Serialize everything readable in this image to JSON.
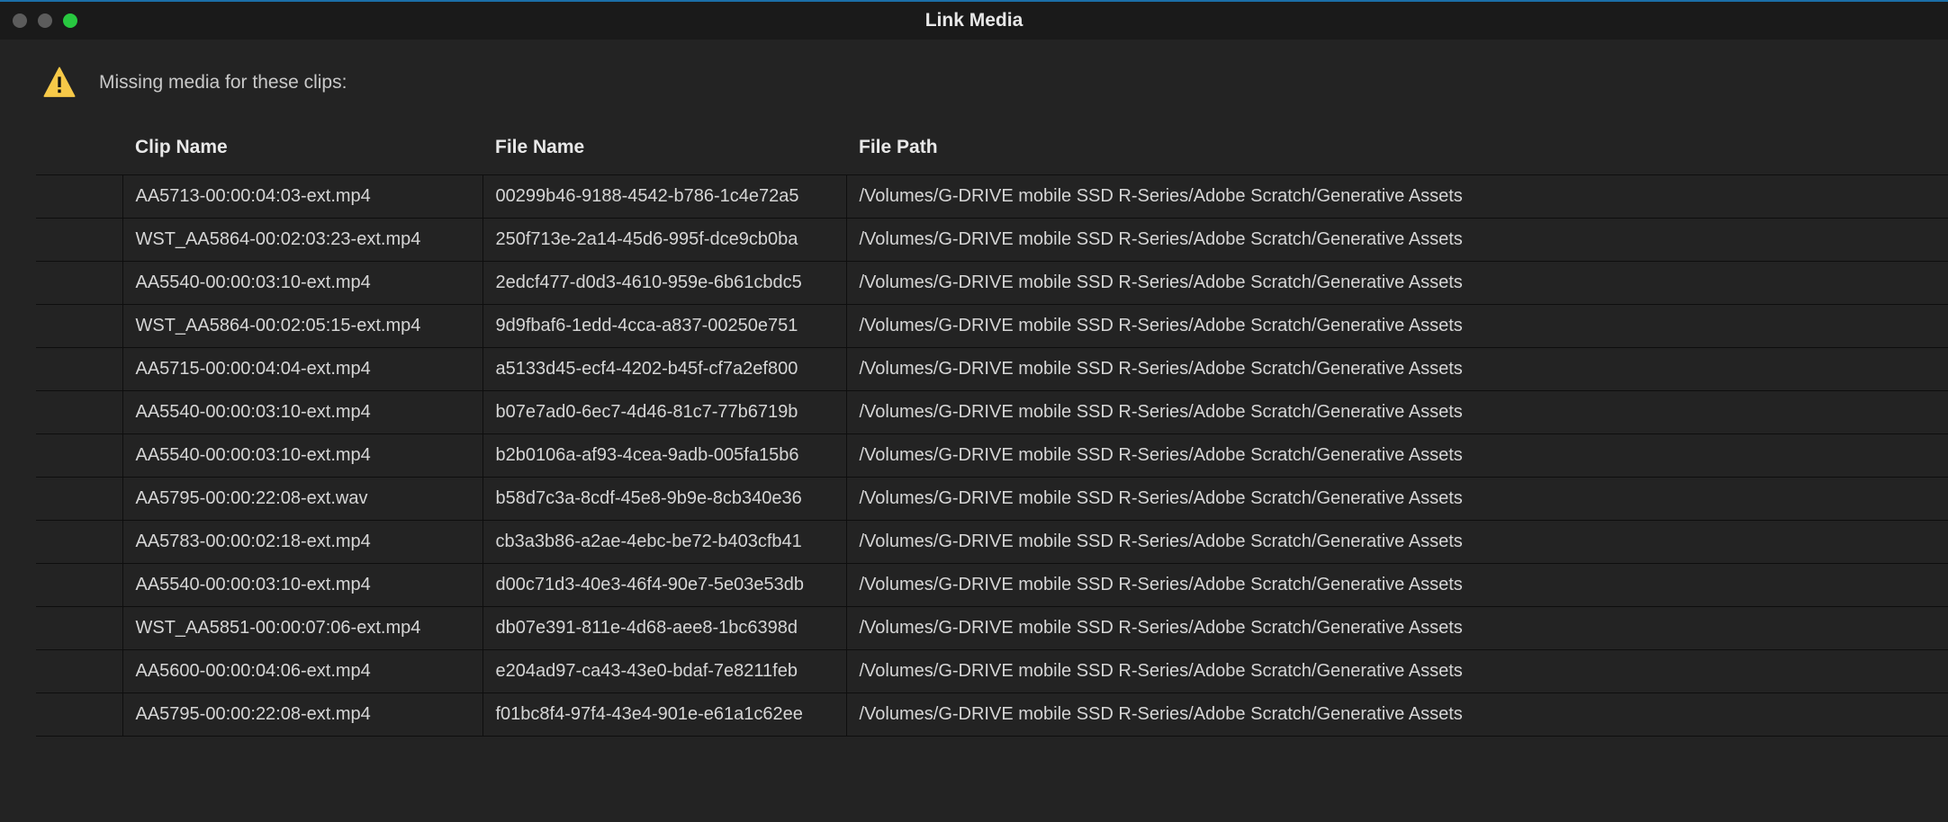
{
  "window": {
    "title": "Link Media"
  },
  "message": "Missing media for these clips:",
  "columns": {
    "clip": "Clip Name",
    "file": "File Name",
    "path": "File Path"
  },
  "rows": [
    {
      "clip": "AA5713-00:00:04:03-ext.mp4",
      "file": "00299b46-9188-4542-b786-1c4e72a5",
      "path": "/Volumes/G-DRIVE mobile SSD R-Series/Adobe Scratch/Generative Assets"
    },
    {
      "clip": "WST_AA5864-00:02:03:23-ext.mp4",
      "file": "250f713e-2a14-45d6-995f-dce9cb0ba",
      "path": "/Volumes/G-DRIVE mobile SSD R-Series/Adobe Scratch/Generative Assets"
    },
    {
      "clip": "AA5540-00:00:03:10-ext.mp4",
      "file": "2edcf477-d0d3-4610-959e-6b61cbdc5",
      "path": "/Volumes/G-DRIVE mobile SSD R-Series/Adobe Scratch/Generative Assets"
    },
    {
      "clip": "WST_AA5864-00:02:05:15-ext.mp4",
      "file": "9d9fbaf6-1edd-4cca-a837-00250e751",
      "path": "/Volumes/G-DRIVE mobile SSD R-Series/Adobe Scratch/Generative Assets"
    },
    {
      "clip": "AA5715-00:00:04:04-ext.mp4",
      "file": "a5133d45-ecf4-4202-b45f-cf7a2ef800",
      "path": "/Volumes/G-DRIVE mobile SSD R-Series/Adobe Scratch/Generative Assets"
    },
    {
      "clip": "AA5540-00:00:03:10-ext.mp4",
      "file": "b07e7ad0-6ec7-4d46-81c7-77b6719b",
      "path": "/Volumes/G-DRIVE mobile SSD R-Series/Adobe Scratch/Generative Assets"
    },
    {
      "clip": "AA5540-00:00:03:10-ext.mp4",
      "file": "b2b0106a-af93-4cea-9adb-005fa15b6",
      "path": "/Volumes/G-DRIVE mobile SSD R-Series/Adobe Scratch/Generative Assets"
    },
    {
      "clip": "AA5795-00:00:22:08-ext.wav",
      "file": "b58d7c3a-8cdf-45e8-9b9e-8cb340e36",
      "path": "/Volumes/G-DRIVE mobile SSD R-Series/Adobe Scratch/Generative Assets"
    },
    {
      "clip": "AA5783-00:00:02:18-ext.mp4",
      "file": "cb3a3b86-a2ae-4ebc-be72-b403cfb41",
      "path": "/Volumes/G-DRIVE mobile SSD R-Series/Adobe Scratch/Generative Assets"
    },
    {
      "clip": "AA5540-00:00:03:10-ext.mp4",
      "file": "d00c71d3-40e3-46f4-90e7-5e03e53db",
      "path": "/Volumes/G-DRIVE mobile SSD R-Series/Adobe Scratch/Generative Assets"
    },
    {
      "clip": "WST_AA5851-00:00:07:06-ext.mp4",
      "file": "db07e391-811e-4d68-aee8-1bc6398d",
      "path": "/Volumes/G-DRIVE mobile SSD R-Series/Adobe Scratch/Generative Assets"
    },
    {
      "clip": "AA5600-00:00:04:06-ext.mp4",
      "file": "e204ad97-ca43-43e0-bdaf-7e8211feb",
      "path": "/Volumes/G-DRIVE mobile SSD R-Series/Adobe Scratch/Generative Assets"
    },
    {
      "clip": "AA5795-00:00:22:08-ext.mp4",
      "file": "f01bc8f4-97f4-43e4-901e-e61a1c62ee",
      "path": "/Volumes/G-DRIVE mobile SSD R-Series/Adobe Scratch/Generative Assets"
    }
  ]
}
